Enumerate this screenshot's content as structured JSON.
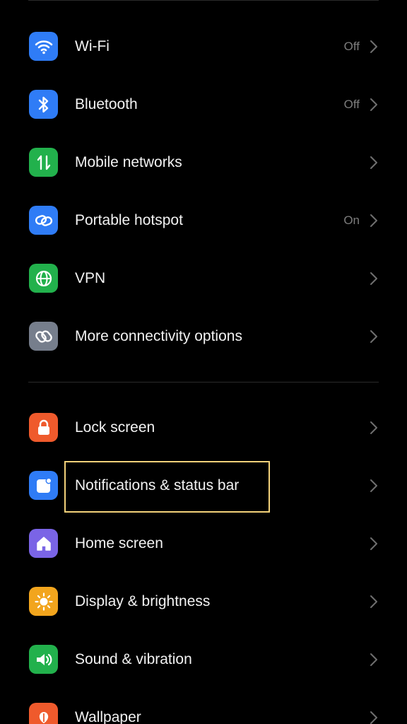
{
  "connectivity": [
    {
      "label": "Wi-Fi",
      "status": "Off",
      "icon": "wifi-icon",
      "color": "#2f7cf6"
    },
    {
      "label": "Bluetooth",
      "status": "Off",
      "icon": "bluetooth-icon",
      "color": "#2f7cf6"
    },
    {
      "label": "Mobile networks",
      "status": "",
      "icon": "mobile-data-icon",
      "color": "#22b14c"
    },
    {
      "label": "Portable hotspot",
      "status": "On",
      "icon": "hotspot-link-icon",
      "color": "#2f7cf6"
    },
    {
      "label": "VPN",
      "status": "",
      "icon": "globe-icon",
      "color": "#22b14c"
    },
    {
      "label": "More connectivity options",
      "status": "",
      "icon": "link-icon",
      "color": "#767e8c"
    }
  ],
  "personalization": [
    {
      "label": "Lock screen",
      "icon": "lock-icon",
      "color": "#ef5a2c"
    },
    {
      "label": "Notifications & status bar",
      "icon": "notification-icon",
      "color": "#2f7cf6"
    },
    {
      "label": "Home screen",
      "icon": "home-icon",
      "color": "#7a64e6"
    },
    {
      "label": "Display & brightness",
      "icon": "sun-icon",
      "color": "#f2a51d"
    },
    {
      "label": "Sound & vibration",
      "icon": "speaker-icon",
      "color": "#22b14c"
    },
    {
      "label": "Wallpaper",
      "icon": "wallpaper-icon",
      "color": "#ef5a2c"
    }
  ],
  "highlight_color": "#f3d27a"
}
